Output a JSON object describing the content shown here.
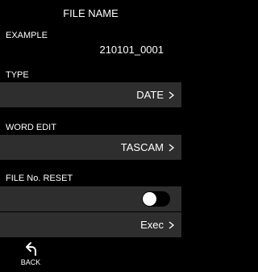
{
  "header": {
    "title": "FILE NAME"
  },
  "example": {
    "label": "EXAMPLE",
    "value": "210101_0001"
  },
  "type": {
    "label": "TYPE",
    "value": "DATE"
  },
  "word_edit": {
    "label": "WORD EDIT",
    "value": "TASCAM"
  },
  "file_no_reset": {
    "label": "FILE No. RESET",
    "toggle_on": false,
    "exec_label": "Exec"
  },
  "footer": {
    "back_label": "BACK"
  },
  "colors": {
    "background": "#000000",
    "row": "#2e2e2e",
    "text": "#ffffff"
  }
}
